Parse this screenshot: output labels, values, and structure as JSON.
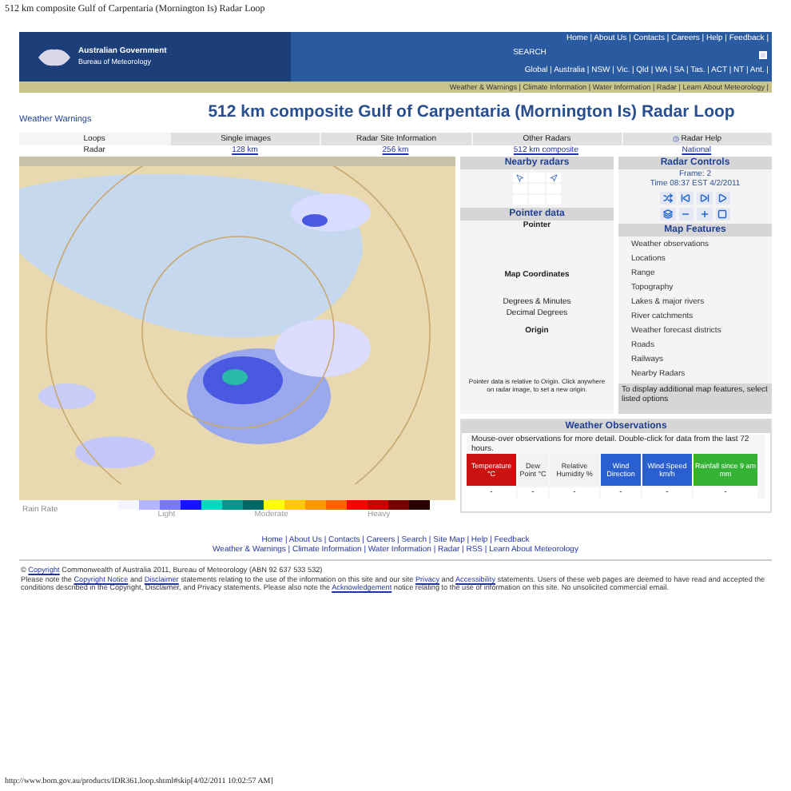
{
  "print_header": "512 km composite Gulf of Carpentaria (Mornington Is) Radar Loop",
  "banner": {
    "agency_lines": [
      "Australian Government",
      "Bureau of Meteorology"
    ],
    "top_links": "Home | About Us | Contacts | Careers | Help | Feedback |",
    "search_label": "SEARCH",
    "region_links": "Global | Australia | NSW | Vic. | Qld | WA | SA | Tas. | ACT | NT | Ant. |",
    "nav_links": "Weather & Warnings | Climate Information | Water Information | Radar | Learn About Meteorology |"
  },
  "warnings_link": "Weather Warnings",
  "title": "512 km composite Gulf of Carpentaria (Mornington Is) Radar Loop",
  "tabs": [
    {
      "label": "Loops",
      "selected": true
    },
    {
      "label": "Single images",
      "selected": false
    },
    {
      "label": "Radar Site Information",
      "selected": false
    },
    {
      "label": "Other Radars",
      "selected": false
    },
    {
      "label": "Radar Help",
      "selected": false
    }
  ],
  "range_row": [
    {
      "label": "Radar",
      "kind": "text"
    },
    {
      "label": "128 km",
      "kind": "link"
    },
    {
      "label": "256 km",
      "kind": "link"
    },
    {
      "label": "512 km composite",
      "kind": "link"
    },
    {
      "label": "National",
      "kind": "link"
    }
  ],
  "rain_rate": {
    "label": "Rain Rate",
    "swatches": [
      {
        "color": "#f5f5ff"
      },
      {
        "color": "#b4b4ff"
      },
      {
        "color": "#7878ff"
      },
      {
        "color": "#1414ff"
      },
      {
        "color": "#00d8c3"
      },
      {
        "color": "#009690"
      },
      {
        "color": "#006666"
      },
      {
        "color": "#ffff00"
      },
      {
        "color": "#ffc800"
      },
      {
        "color": "#ff9600"
      },
      {
        "color": "#ff6400"
      },
      {
        "color": "#ff0000"
      },
      {
        "color": "#c80000"
      },
      {
        "color": "#780000"
      },
      {
        "color": "#280000"
      }
    ],
    "levels": [
      "Light",
      "Moderate",
      "Heavy"
    ]
  },
  "nearby_radars": {
    "title": "Nearby radars"
  },
  "pointer_data": {
    "title": "Pointer data",
    "labels": [
      {
        "text": "Pointer",
        "kind": "heading"
      },
      {
        "text": "Map Coordinates",
        "kind": "heading"
      },
      {
        "text": "Degrees & Minutes",
        "kind": "plain"
      },
      {
        "text": "Decimal Degrees",
        "kind": "plain"
      },
      {
        "text": "Origin",
        "kind": "heading"
      }
    ],
    "note": "Pointer data is relative to Origin. Click anywhere on radar image, to set a new origin."
  },
  "radar_controls": {
    "title": "Radar Controls",
    "frame": "Frame: 2",
    "time": "Time 08:37 EST 4/2/2011"
  },
  "map_features": {
    "title": "Map Features",
    "items": [
      "Weather observations",
      "Locations",
      "Range",
      "Topography",
      "Lakes & major rivers",
      "River catchments",
      "Weather forecast districts",
      "Roads",
      "Railways",
      "Nearby Radars"
    ],
    "note": "To display additional map features, select listed options"
  },
  "weather_observations": {
    "title": "Weather Observations",
    "note": "Mouse-over observations for more detail. Double-click for data from the last 72 hours.",
    "columns": [
      {
        "label": "Temperature °C",
        "color": "#cc1111",
        "value": "-"
      },
      {
        "label": "Dew Point °C",
        "color": "#f2f2f2",
        "value": "-"
      },
      {
        "label": "Relative Humidity %",
        "color": "#f2f2f2",
        "value": "-"
      },
      {
        "label": "Wind Direction",
        "color": "#2a5fd0",
        "value": "-"
      },
      {
        "label": "Wind Speed km/h",
        "color": "#2a5fd0",
        "value": "-"
      },
      {
        "label": "Rainfall since 9 am mm",
        "color": "#33b233",
        "value": "-"
      }
    ]
  },
  "footer_links": [
    "Home | About Us | Contacts | Careers | Search | Site Map | Help | Feedback",
    "Weather & Warnings | Climate Information | Water Information | Radar | RSS | Learn About Meteorology"
  ],
  "copyright": [
    {
      "text": "© ",
      "kind": "plain"
    },
    {
      "text": "Copyright",
      "kind": "link"
    },
    {
      "text": " Commonwealth of Australia 2011, Bureau of Meteorology (ABN 92 637 533 532)",
      "kind": "plain"
    }
  ],
  "notice": [
    {
      "text": "Please note the ",
      "kind": "plain"
    },
    {
      "text": "Copyright Notice",
      "kind": "link"
    },
    {
      "text": " and ",
      "kind": "plain"
    },
    {
      "text": "Disclaimer",
      "kind": "link"
    },
    {
      "text": " statements relating to the use of the information on this site and our site ",
      "kind": "plain"
    },
    {
      "text": "Privacy",
      "kind": "link"
    },
    {
      "text": " and ",
      "kind": "plain"
    },
    {
      "text": "Accessibility",
      "kind": "link"
    },
    {
      "text": " statements. Users of these web pages are deemed to have read and accepted the conditions described in the Copyright, Disclaimer, and Privacy statements. Please also note the ",
      "kind": "plain"
    },
    {
      "text": "Acknowledgement",
      "kind": "link"
    },
    {
      "text": " notice relating to the use of information on this site. No unsolicited commercial email.",
      "kind": "plain"
    }
  ],
  "print_footer": "http://www.bom.gov.au/products/IDR361.loop.shtml#skip[4/02/2011 10:02:57 AM]"
}
